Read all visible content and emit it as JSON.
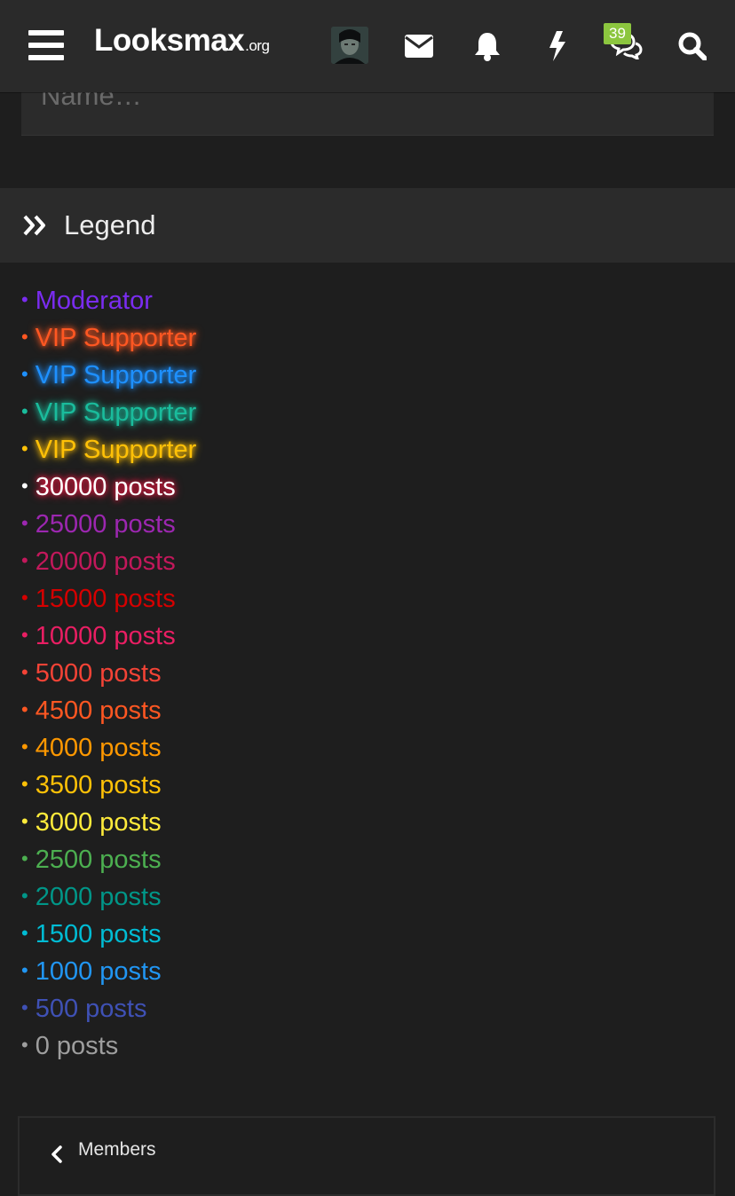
{
  "header": {
    "logo_main": "Looksmax",
    "logo_suffix": ".org",
    "badge_count": "39",
    "icons": [
      "menu-icon",
      "avatar",
      "envelope-icon",
      "bell-icon",
      "bolt-icon",
      "comments-icon",
      "search-icon"
    ]
  },
  "name_filter": {
    "placeholder": "Name…"
  },
  "legend": {
    "title": "Legend",
    "items": [
      {
        "label": "Moderator",
        "color": "#7a2cf0"
      },
      {
        "label": "VIP Supporter",
        "color": "#ff5722",
        "glow": true
      },
      {
        "label": "VIP Supporter",
        "color": "#1e90ff",
        "glow": true
      },
      {
        "label": "VIP Supporter",
        "color": "#1abc9c",
        "glow": true
      },
      {
        "label": "VIP Supporter",
        "color": "#ffc107",
        "glow": true
      },
      {
        "label": "30000 posts",
        "color": "#ffffff",
        "glow": true
      },
      {
        "label": "25000 posts",
        "color": "#9c27b0"
      },
      {
        "label": "20000 posts",
        "color": "#c2185b"
      },
      {
        "label": "15000 posts",
        "color": "#d50000"
      },
      {
        "label": "10000 posts",
        "color": "#e91e63"
      },
      {
        "label": "5000 posts",
        "color": "#f44336"
      },
      {
        "label": "4500 posts",
        "color": "#ff5722"
      },
      {
        "label": "4000 posts",
        "color": "#ff9800"
      },
      {
        "label": "3500 posts",
        "color": "#ffc107"
      },
      {
        "label": "3000 posts",
        "color": "#ffeb3b"
      },
      {
        "label": "2500 posts",
        "color": "#4caf50"
      },
      {
        "label": "2000 posts",
        "color": "#009688"
      },
      {
        "label": "1500 posts",
        "color": "#00bcd4"
      },
      {
        "label": "1000 posts",
        "color": "#2196f3"
      },
      {
        "label": "500 posts",
        "color": "#3f51b5"
      },
      {
        "label": "0 posts",
        "color": "#9e9e9e"
      }
    ]
  },
  "footer_nav": {
    "label": "Members"
  }
}
